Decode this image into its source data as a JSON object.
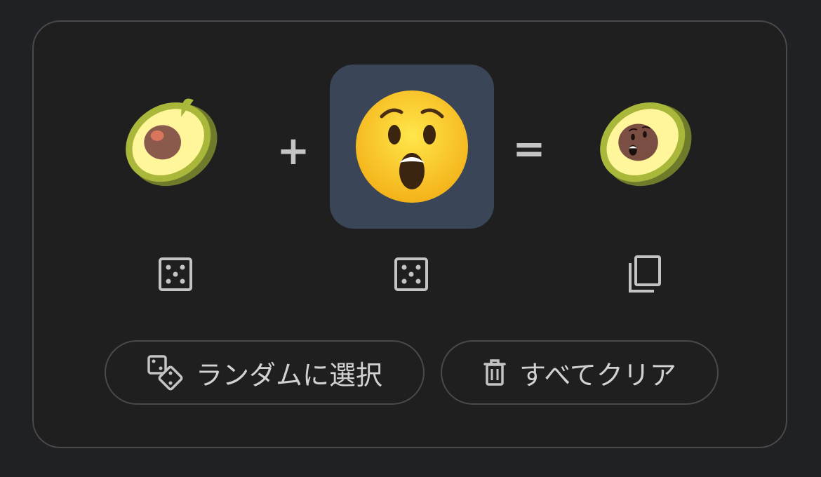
{
  "mixer": {
    "left_emoji": {
      "name": "avocado-icon"
    },
    "right_emoji": {
      "name": "hushed-face-icon"
    },
    "result_emoji": {
      "name": "avocado-hushed-mix-icon"
    },
    "plus": "+",
    "equals": "="
  },
  "colors": {
    "background": "#202124",
    "card": "#1f1f1f",
    "border": "#4a4a4c",
    "selected_slot": "#3a4557",
    "icon": "#c4c4c4"
  },
  "actions": {
    "random_label": "ランダムに選択",
    "clear_label": "すべてクリア"
  }
}
